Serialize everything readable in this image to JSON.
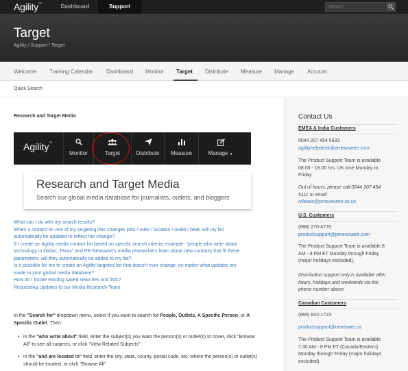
{
  "topbar": {
    "logo": "Agility",
    "logo_mark": "™",
    "nav": [
      "Dashboard",
      "Support"
    ],
    "search_placeholder": "Search"
  },
  "header": {
    "title": "Target",
    "breadcrumb": "Agility  /   Support  /   Target"
  },
  "mainnav": [
    "Welcome",
    "Training Calendar",
    "Dashboard",
    "Monitor",
    "Target",
    "Distribute",
    "Measure",
    "Manage",
    "Account"
  ],
  "subnav": "Quick Search",
  "main": {
    "section_title": "Research and Target Media",
    "banner": {
      "logo": "Agility",
      "logo_mark": "™",
      "items": [
        "Monitor",
        "Target",
        "Distribute",
        "Measure",
        "Manage"
      ]
    },
    "big_title": "Research and Target Media",
    "big_subtitle": "Search our global media database for journalists, outlets, and bloggers",
    "faq_links": [
      "What can I do with my search results?",
      "When a contact on one of my targeting lists changes jobs / roles / location / outlet / beat, will my list",
      "automatically be updated to reflect the change?",
      "If I create an Agility media contact list based on specific search criteria, example: \"people who write about",
      "technology in Dallas, Texas\" and PR Newswire's media researchers learn about new contacts that fit these",
      "parameters, will they automatically be added to my list?",
      "Is it possible for me to create an Agility targeted list that doesn't ever change, no matter what updates are",
      "made to your global media database?",
      "How do I locate existing saved searches and lists?",
      "Requesting Updates to our Media Research Team"
    ],
    "para": {
      "p1": "In the ",
      "b1": "\"Search for\"",
      "p2": " dropdown menu, select if you want to search for ",
      "b2": "People, Outlets, A Specific Person",
      "p3": ", or ",
      "b3": "A Specific Outlet",
      "p4": ". Then:"
    },
    "bullet1": {
      "p1": "in the ",
      "b1": "\"who write about\"",
      "p2": " field, enter the subject(s) you want the person(s) or outlet(s) to cover, click \"Browse All\" to see all subjects, or click \"View Related Subjects\""
    },
    "bullet2": {
      "p1": "in the ",
      "b1": "\"and are located in\"",
      "p2": " field, enter the city, state, county, postal code, etc. where the person(s) or outlet(s) should be located, or click \"Browse All\""
    },
    "bullet_glyph": "•"
  },
  "sidebar": {
    "title": "Contact Us",
    "emea": {
      "heading": "EMEA & India Customers",
      "phone": "0044 207 454 5333",
      "email": "agilityhelpdesk@prnewswire.com",
      "hours_l1": "The Product Support Team is available",
      "hours_l2": "08.00 - 18.00 hrs. UK time Monday to",
      "hours_l3": "Friday.",
      "ooh_l1": "Out of hours, please call 0044 207 454",
      "ooh_l2": "5111 or email",
      "ooh_email": "release@prnewswire.co.uk",
      "ooh_end": "."
    },
    "us": {
      "heading": "U.S. Customers",
      "phone": "(888) 270-4776",
      "email": "productsupport@prnewswire.com",
      "hours_l1": "The Product Support Team is available 8",
      "hours_l2": "AM - 9 PM ET Monday through Friday",
      "hours_l3": "(major holidays excluded).",
      "note_l1": "Distribution support only is available after",
      "note_l2": "hours, holidays and weekends via the",
      "note_l3": "phone number above."
    },
    "canada": {
      "heading": "Canadian Customers",
      "phone": "(866) 842-1723",
      "email": "productsupport@newswire.ca",
      "hours_l1": "The Product Support Team is available",
      "hours_l2": "7:30 AM - 8 PM ET (Canada/Eastern)",
      "hours_l3": "Monday through Friday (major holidays",
      "hours_l4": "excluded)."
    }
  },
  "colors": {
    "topbar": "#1f1f1f",
    "header": "#2e2e2e",
    "link": "#3a79b6",
    "highlight_circle": "#c01818",
    "sidebar_bg": "#f6f6f6"
  }
}
